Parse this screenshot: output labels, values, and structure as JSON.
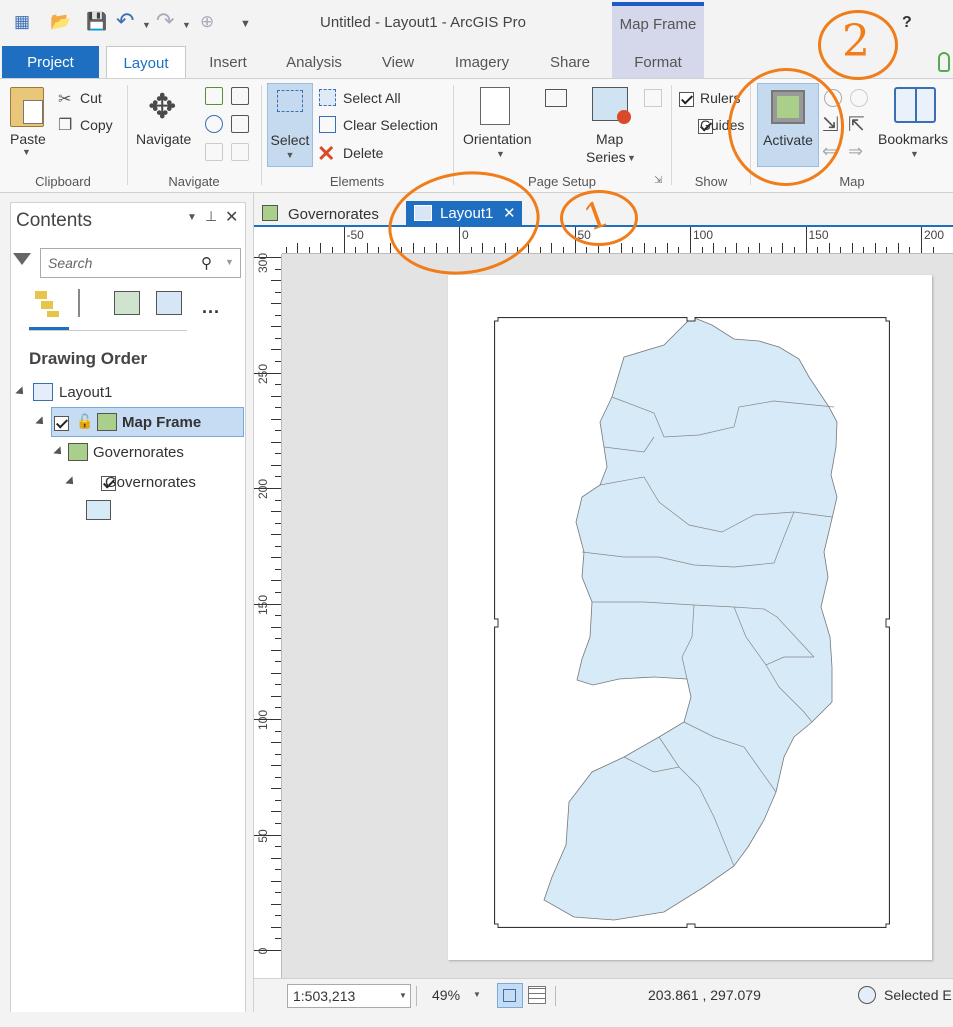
{
  "window": {
    "title": "Untitled - Layout1 - ArcGIS Pro",
    "help": "?"
  },
  "contextual": {
    "group_label": "Map Frame"
  },
  "tabs": [
    {
      "label": "Project"
    },
    {
      "label": "Layout"
    },
    {
      "label": "Insert"
    },
    {
      "label": "Analysis"
    },
    {
      "label": "View"
    },
    {
      "label": "Imagery"
    },
    {
      "label": "Share"
    },
    {
      "label": "Format"
    }
  ],
  "ribbon": {
    "clipboard": {
      "group": "Clipboard",
      "paste": "Paste",
      "cut": "Cut",
      "copy": "Copy"
    },
    "navigate": {
      "group": "Navigate",
      "navigate": "Navigate"
    },
    "elements": {
      "group": "Elements",
      "select": "Select",
      "select_all": "Select All",
      "clear_selection": "Clear Selection",
      "delete": "Delete"
    },
    "page_setup": {
      "group": "Page Setup",
      "orientation": "Orientation",
      "map_series_1": "Map",
      "map_series_2": "Series"
    },
    "show": {
      "group": "Show",
      "rulers": "Rulers",
      "guides": "Guides"
    },
    "map": {
      "group": "Map",
      "activate": "Activate",
      "bookmarks": "Bookmarks"
    }
  },
  "contents": {
    "title": "Contents",
    "search_placeholder": "Search",
    "more": "...",
    "heading": "Drawing Order",
    "tree": {
      "layout": "Layout1",
      "map_frame": "Map Frame",
      "map": "Governorates",
      "layer": "Governorates"
    }
  },
  "doc_tabs": [
    {
      "label": "Governorates"
    },
    {
      "label": "Layout1"
    }
  ],
  "rulers": {
    "h_labels": [
      "-50",
      "0",
      "50",
      "100",
      "150",
      "200"
    ],
    "v_labels": [
      "300",
      "250",
      "200",
      "150",
      "100",
      "50",
      "0"
    ]
  },
  "status": {
    "scale": "1:503,213",
    "zoom": "49%",
    "coords": "203.861 , 297.079",
    "selected": "Selected E"
  },
  "colors": {
    "accent": "#1e6fc2",
    "contextual": "#d4d8ea",
    "map_fill": "#d6eaf8",
    "annotation": "#f07d1a"
  },
  "annotations": [
    "1",
    "2"
  ]
}
